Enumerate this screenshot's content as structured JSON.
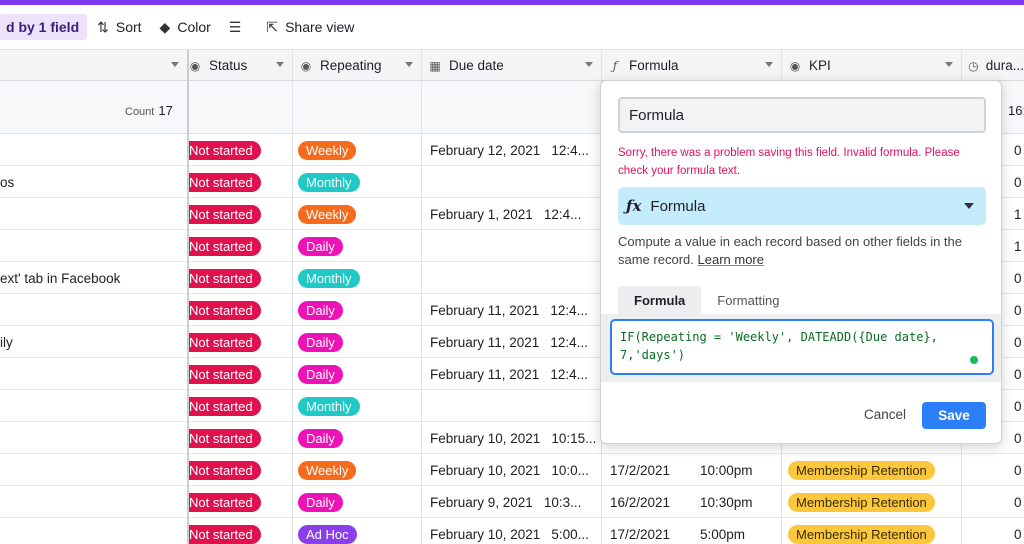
{
  "toolbar": {
    "grouped_label": "d by 1 field",
    "sort_label": "Sort",
    "color_label": "Color",
    "share_label": "Share view"
  },
  "columns": {
    "status": "Status",
    "repeating": "Repeating",
    "due_date": "Due date",
    "formula": "Formula",
    "kpi": "KPI",
    "duration": "dura..."
  },
  "summary": {
    "count_label": "Count",
    "count_value": "17",
    "duration_partial": "16:"
  },
  "colors": {
    "accent": "#7c37ef",
    "not_started": "#e0114f",
    "weekly": "#f76b1c",
    "monthly": "#20c9c5",
    "daily": "#ee11b7",
    "adhoc": "#8b3fea",
    "kpi": "#fcc73a",
    "save": "#2d7ff9",
    "error": "#e0115f"
  },
  "rows": [
    {
      "name": "",
      "status": "Not started",
      "repeating": "Weekly",
      "rep_color": "#f76b1c",
      "due": "February 12, 2021",
      "time": "12:4...",
      "f_date": "",
      "f_time": "",
      "kpi": "",
      "dur": "0"
    },
    {
      "name": "os",
      "status": "Not started",
      "repeating": "Monthly",
      "rep_color": "#20c9c5",
      "due": "",
      "time": "",
      "f_date": "",
      "f_time": "",
      "kpi": "",
      "dur": "0"
    },
    {
      "name": "",
      "status": "Not started",
      "repeating": "Weekly",
      "rep_color": "#f76b1c",
      "due": "February 1, 2021",
      "time": "12:4...",
      "f_date": "",
      "f_time": "",
      "kpi": "",
      "dur": "1"
    },
    {
      "name": "",
      "status": "Not started",
      "repeating": "Daily",
      "rep_color": "#ee11b7",
      "due": "",
      "time": "",
      "f_date": "",
      "f_time": "",
      "kpi": "",
      "dur": "1"
    },
    {
      "name": "ext' tab in Facebook",
      "status": "Not started",
      "repeating": "Monthly",
      "rep_color": "#20c9c5",
      "due": "",
      "time": "",
      "f_date": "",
      "f_time": "",
      "kpi": "",
      "dur": "0"
    },
    {
      "name": "",
      "status": "Not started",
      "repeating": "Daily",
      "rep_color": "#ee11b7",
      "due": "February 11, 2021",
      "time": "12:4...",
      "f_date": "",
      "f_time": "",
      "kpi": "",
      "dur": "0"
    },
    {
      "name": "ily",
      "status": "Not started",
      "repeating": "Daily",
      "rep_color": "#ee11b7",
      "due": "February 11, 2021",
      "time": "12:4...",
      "f_date": "",
      "f_time": "",
      "kpi": "",
      "dur": "0"
    },
    {
      "name": "",
      "status": "Not started",
      "repeating": "Daily",
      "rep_color": "#ee11b7",
      "due": "February 11, 2021",
      "time": "12:4...",
      "f_date": "",
      "f_time": "",
      "kpi": "",
      "dur": "0"
    },
    {
      "name": "",
      "status": "Not started",
      "repeating": "Monthly",
      "rep_color": "#20c9c5",
      "due": "",
      "time": "",
      "f_date": "",
      "f_time": "",
      "kpi": "",
      "dur": "0"
    },
    {
      "name": "",
      "status": "Not started",
      "repeating": "Daily",
      "rep_color": "#ee11b7",
      "due": "February 10, 2021",
      "time": "10:15...",
      "f_date": "",
      "f_time": "",
      "kpi": "",
      "dur": "0"
    },
    {
      "name": "",
      "status": "Not started",
      "repeating": "Weekly",
      "rep_color": "#f76b1c",
      "due": "February 10, 2021",
      "time": "10:0...",
      "f_date": "17/2/2021",
      "f_time": "10:00pm",
      "kpi": "Membership Retention",
      "dur": "0"
    },
    {
      "name": "",
      "status": "Not started",
      "repeating": "Daily",
      "rep_color": "#ee11b7",
      "due": "February 9, 2021",
      "time": "10:3...",
      "f_date": "16/2/2021",
      "f_time": "10:30pm",
      "kpi": "Membership Retention",
      "dur": "0"
    },
    {
      "name": "",
      "status": "Not started",
      "repeating": "Ad Hoc",
      "rep_color": "#8b3fea",
      "due": "February 10, 2021",
      "time": "5:00...",
      "f_date": "17/2/2021",
      "f_time": "5:00pm",
      "kpi": "Membership Retention",
      "dur": "0"
    }
  ],
  "panel": {
    "field_name": "Formula",
    "error": "Sorry, there was a problem saving this field. Invalid formula. Please check your formula text.",
    "field_type": "Formula",
    "description": "Compute a value in each record based on other fields in the same record.",
    "learn_more": "Learn more",
    "tab_formula": "Formula",
    "tab_formatting": "Formatting",
    "formula_text": "IF(Repeating = 'Weekly', DATEADD({Due date},\n7,'days')",
    "cancel": "Cancel",
    "save": "Save"
  }
}
